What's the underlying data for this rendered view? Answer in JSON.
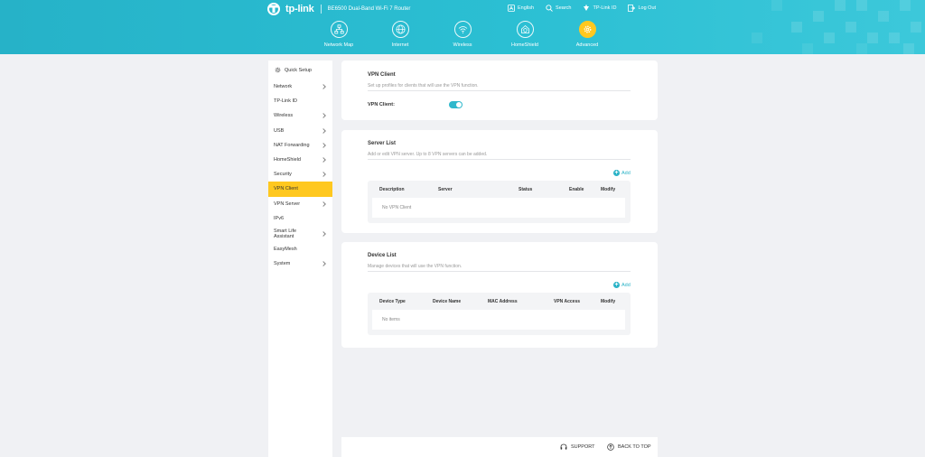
{
  "header": {
    "brand": "tp-link",
    "model": "BE6500 Dual-Band Wi-Fi 7 Router",
    "top_links": [
      {
        "label": "English",
        "icon": "language-icon"
      },
      {
        "label": "Search",
        "icon": "search-icon"
      },
      {
        "label": "TP-Link ID",
        "icon": "tplink-id-icon"
      },
      {
        "label": "Log Out",
        "icon": "logout-icon"
      }
    ],
    "nav": [
      {
        "label": "Network Map",
        "icon": "network-map-icon"
      },
      {
        "label": "Internet",
        "icon": "globe-icon"
      },
      {
        "label": "Wireless",
        "icon": "wifi-icon"
      },
      {
        "label": "HomeShield",
        "icon": "home-shield-icon"
      },
      {
        "label": "Advanced",
        "icon": "gear-icon",
        "active": true
      }
    ]
  },
  "sidebar": {
    "quick_setup": "Quick Setup",
    "items": [
      {
        "label": "Network",
        "chevron": true
      },
      {
        "label": "TP-Link ID",
        "chevron": false
      },
      {
        "label": "Wireless",
        "chevron": true
      },
      {
        "label": "USB",
        "chevron": true
      },
      {
        "label": "NAT Forwarding",
        "chevron": true
      },
      {
        "label": "HomeShield",
        "chevron": true
      },
      {
        "label": "Security",
        "chevron": true
      },
      {
        "label": "VPN Client",
        "chevron": false,
        "active": true
      },
      {
        "label": "VPN Server",
        "chevron": true
      },
      {
        "label": "IPv6",
        "chevron": false
      },
      {
        "label": "Smart Life Assistant",
        "chevron": true
      },
      {
        "label": "EasyMesh",
        "chevron": false
      },
      {
        "label": "System",
        "chevron": true
      }
    ]
  },
  "vpn_client": {
    "title": "VPN Client",
    "description": "Set up profiles for clients that will use the VPN function.",
    "toggle_label": "VPN Client:",
    "enabled": true
  },
  "server_list": {
    "title": "Server List",
    "description": "Add or edit VPN server. Up to 8 VPN servers can be added.",
    "add_label": "Add",
    "columns": [
      "Description",
      "Server",
      "Status",
      "Enable",
      "Modify"
    ],
    "empty_text": "No VPN Client"
  },
  "device_list": {
    "title": "Device List",
    "description": "Manage devices that will use the VPN function.",
    "add_label": "Add",
    "columns": [
      "Device Type",
      "Device Name",
      "MAC Address",
      "VPN Access",
      "Modify"
    ],
    "empty_text": "No items"
  },
  "footer": {
    "support": "SUPPORT",
    "back_to_top": "BACK TO TOP"
  },
  "colors": {
    "header": "#2bbfd3",
    "accent": "#2bb3c7",
    "active": "#ffc81f"
  }
}
